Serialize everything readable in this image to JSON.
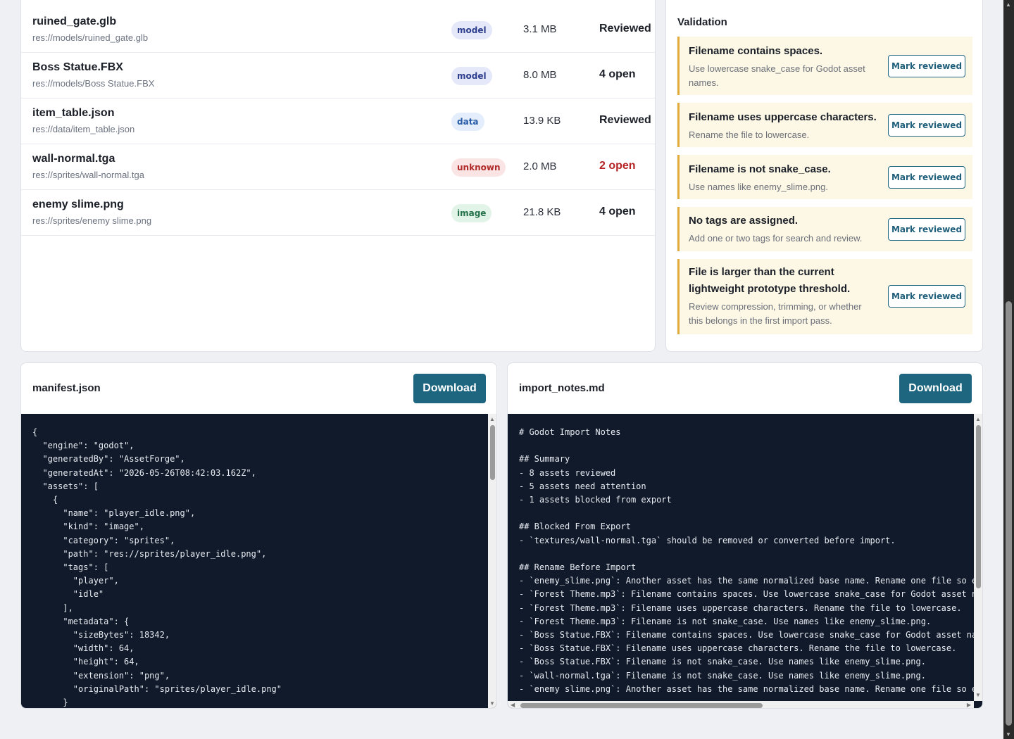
{
  "assets": [
    {
      "name": "ruined_gate.glb",
      "path": "res://models/ruined_gate.glb",
      "kind": "model",
      "size": "3.1 MB",
      "status": "Reviewed",
      "status_tone": "normal"
    },
    {
      "name": "Boss Statue.FBX",
      "path": "res://models/Boss Statue.FBX",
      "kind": "model",
      "size": "8.0 MB",
      "status": "4 open",
      "status_tone": "normal"
    },
    {
      "name": "item_table.json",
      "path": "res://data/item_table.json",
      "kind": "data",
      "size": "13.9 KB",
      "status": "Reviewed",
      "status_tone": "normal"
    },
    {
      "name": "wall-normal.tga",
      "path": "res://sprites/wall-normal.tga",
      "kind": "unknown",
      "size": "2.0 MB",
      "status": "2 open",
      "status_tone": "danger"
    },
    {
      "name": "enemy slime.png",
      "path": "res://sprites/enemy slime.png",
      "kind": "image",
      "size": "21.8 KB",
      "status": "4 open",
      "status_tone": "normal"
    }
  ],
  "validation": {
    "title": "Validation",
    "issues": [
      {
        "title": "Filename contains spaces.",
        "description": "Use lowercase snake_case for Godot asset names.",
        "action": "Mark reviewed"
      },
      {
        "title": "Filename uses uppercase characters.",
        "description": "Rename the file to lowercase.",
        "action": "Mark reviewed"
      },
      {
        "title": "Filename is not snake_case.",
        "description": "Use names like enemy_slime.png.",
        "action": "Mark reviewed"
      },
      {
        "title": "No tags are assigned.",
        "description": "Add one or two tags for search and review.",
        "action": "Mark reviewed"
      },
      {
        "title": "File is larger than the current lightweight prototype threshold.",
        "description": "Review compression, trimming, or whether this belongs in the first import pass.",
        "action": "Mark reviewed"
      }
    ]
  },
  "manifest": {
    "title": "manifest.json",
    "download_label": "Download",
    "content": "{\n  \"engine\": \"godot\",\n  \"generatedBy\": \"AssetForge\",\n  \"generatedAt\": \"2026-05-26T08:42:03.162Z\",\n  \"assets\": [\n    {\n      \"name\": \"player_idle.png\",\n      \"kind\": \"image\",\n      \"category\": \"sprites\",\n      \"path\": \"res://sprites/player_idle.png\",\n      \"tags\": [\n        \"player\",\n        \"idle\"\n      ],\n      \"metadata\": {\n        \"sizeBytes\": 18342,\n        \"width\": 64,\n        \"height\": 64,\n        \"extension\": \"png\",\n        \"originalPath\": \"sprites/player_idle.png\"\n      }"
  },
  "notes": {
    "title": "import_notes.md",
    "download_label": "Download",
    "content": "# Godot Import Notes\n\n## Summary\n- 8 assets reviewed\n- 5 assets need attention\n- 1 assets blocked from export\n\n## Blocked From Export\n- `textures/wall-normal.tga` should be removed or converted before import.\n\n## Rename Before Import\n- `enemy_slime.png`: Another asset has the same normalized base name. Rename one file so exp\n- `Forest Theme.mp3`: Filename contains spaces. Use lowercase snake_case for Godot asset nam\n- `Forest Theme.mp3`: Filename uses uppercase characters. Rename the file to lowercase.\n- `Forest Theme.mp3`: Filename is not snake_case. Use names like enemy_slime.png.\n- `Boss Statue.FBX`: Filename contains spaces. Use lowercase snake_case for Godot asset name\n- `Boss Statue.FBX`: Filename uses uppercase characters. Rename the file to lowercase.\n- `Boss Statue.FBX`: Filename is not snake_case. Use names like enemy_slime.png.\n- `wall-normal.tga`: Filename is not snake_case. Use names like enemy_slime.png.\n- `enemy slime.png`: Another asset has the same normalized base name. Rename one file so exp"
  },
  "icons": {
    "scroll_up": "scroll-up-arrow-icon",
    "scroll_down": "scroll-down-arrow-icon",
    "scroll_left": "scroll-left-arrow-icon",
    "scroll_right": "scroll-right-arrow-icon"
  },
  "colors": {
    "accent": "#1e6680",
    "warning_border": "#e2a93b",
    "danger": "#b52525",
    "code_bg": "#111a2b"
  }
}
